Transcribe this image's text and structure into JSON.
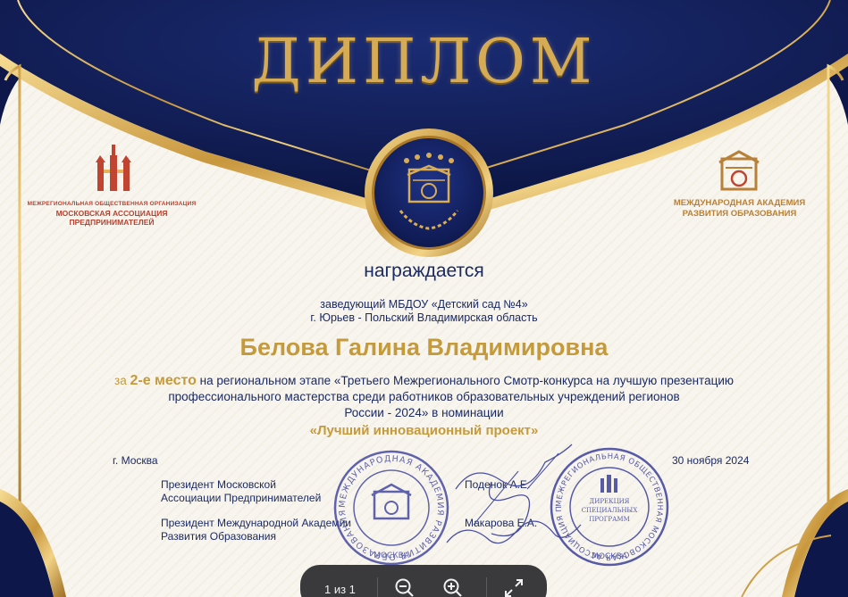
{
  "title": "ДИПЛОМ",
  "org_left": {
    "line1": "МЕЖРЕГИОНАЛЬНАЯ ОБЩЕСТВЕННАЯ ОРГАНИЗАЦИЯ",
    "line2": "МОСКОВСКАЯ АССОЦИАЦИЯ",
    "line3": "ПРЕДПРИНИМАТЕЛЕЙ"
  },
  "org_right": {
    "line1": "МЕЖДУНАРОДНАЯ АКАДЕМИЯ",
    "line2": "РАЗВИТИЯ ОБРАЗОВАНИЯ"
  },
  "awarded": "награждается",
  "position_line1": "заведующий МБДОУ «Детский сад №4»",
  "position_line2": "г. Юрьев - Польский Владимирская область",
  "recipient": "Белова Галина Владимировна",
  "description": {
    "prefix": "за ",
    "place": "2-е место",
    "line1_rest": " на региональном этапе «Третьего Межрегионального Смотр-конкурса на лучшую презентацию",
    "line2": "профессионального мастерства среди работников образовательных учреждений регионов",
    "line3_a": "России - 2024» ",
    "line3_b": "в номинации"
  },
  "nomination": "«Лучший инновационный проект»",
  "city": "г. Москва",
  "date": "30 ноября 2024",
  "signatures": [
    {
      "title_line1": "Президент Московской",
      "title_line2": "Ассоциации Предпринимателей",
      "name": "Поденок А.Е."
    },
    {
      "title_line1": "Президент Международной Академии",
      "title_line2": "Развития Образования",
      "name": "Макарова Е.А."
    }
  ],
  "stamps": {
    "left_ring": "МЕЖДУНАРОДНАЯ АКАДЕМИЯ РАЗВИТИЯ ОБРАЗОВАНИЯ",
    "left_bottom": "МОСКВА",
    "right_ring": "МЕЖРЕГИОНАЛЬНАЯ ОБЩЕСТВЕННАЯ МОСКОВСКАЯ АССОЦИАЦИЯ ПРЕДПРИНИМАТЕЛЕЙ",
    "right_center_1": "ДИРЕКЦИЯ",
    "right_center_2": "СПЕЦИАЛЬНЫХ",
    "right_center_3": "ПРОГРАММ",
    "right_bottom": "МОСКВА"
  },
  "toolbar": {
    "page_indicator": "1 из 1"
  },
  "colors": {
    "navy": "#101b4e",
    "gold": "#c49a3a",
    "text": "#1b2a62",
    "stamp": "#3b3f9b"
  }
}
